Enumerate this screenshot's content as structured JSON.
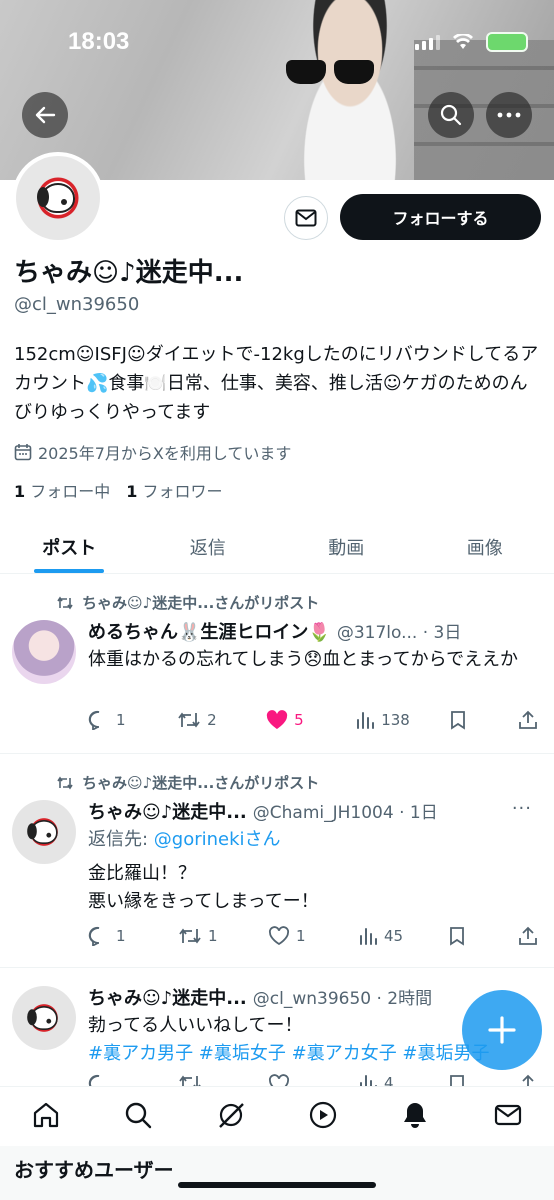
{
  "status": {
    "time": "18:03"
  },
  "profile": {
    "follow_label": "フォローする",
    "display_name": "ちゃみ☺︎♪迷走中...",
    "handle": "@cl_wn39650",
    "bio": "152cm☺︎ISFJ☺︎ダイエットで-12kgしたのにリバウンドしてるアカウント💦食事🍽️日常、仕事、美容、推し活☺︎ケガのためのんびりゆっくりやってます",
    "joined": "2025年7月からXを利用しています",
    "following_count": "1",
    "following_label": "フォロー中",
    "followers_count": "1",
    "followers_label": "フォロワー"
  },
  "tabs": [
    "ポスト",
    "返信",
    "動画",
    "画像"
  ],
  "posts": [
    {
      "repost_label": "ちゃみ☺︎♪迷走中...さんがリポスト",
      "name": "めるちゃん🐰生涯ヒロイン🌷",
      "meta": "@317lo... · 3日",
      "text": "体重はかるの忘れてしまう😞血とまってからでええか",
      "replies": "1",
      "reposts": "2",
      "likes": "5",
      "views": "138"
    },
    {
      "repost_label": "ちゃみ☺︎♪迷走中...さんがリポスト",
      "name": "ちゃみ☺︎♪迷走中...",
      "meta": "@Chami_JH1004 · 1日",
      "reply_to_prefix": "返信先: ",
      "reply_to_user": "@gorineki",
      "reply_to_suffix": "さん",
      "text_line1": "金比羅山！？",
      "text_line2": "悪い縁をきってしまってー！",
      "replies": "1",
      "reposts": "1",
      "likes": "1",
      "views": "45"
    },
    {
      "name": "ちゃみ☺︎♪迷走中...",
      "meta": "@cl_wn39650 · 2時間",
      "text": "勃ってる人いいねしてー！",
      "hashtags": "#裏アカ男子 #裏垢女子 #裏アカ女子 #裏垢男子",
      "views": "4"
    }
  ],
  "suggest_title": "おすすめユーザー",
  "colors": {
    "accent": "#1d9bf0",
    "like": "#f91880",
    "text": "#0f1419",
    "muted": "#536471"
  }
}
